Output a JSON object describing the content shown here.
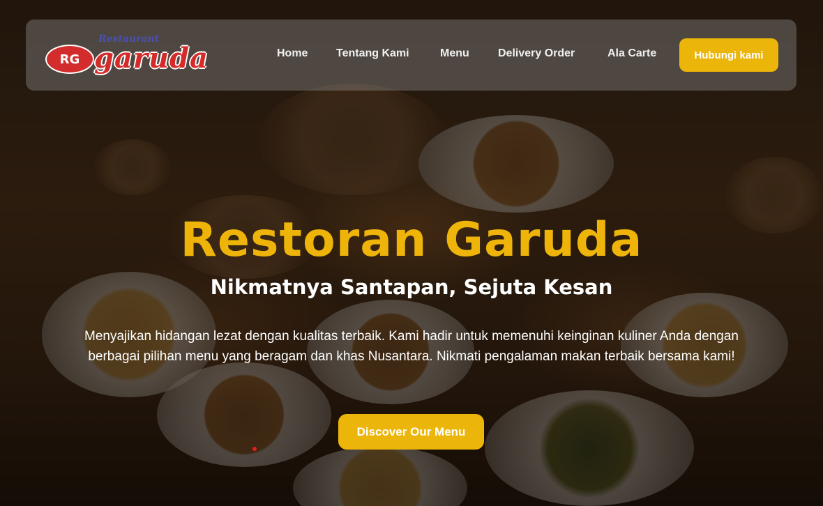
{
  "brand": {
    "logo_small_text": "Restaurant",
    "logo_word": "garuda",
    "logo_emblem_text": "RG",
    "colors": {
      "primary_yellow": "#ecb50a",
      "logo_red": "#d52a2a"
    }
  },
  "nav": {
    "items": [
      {
        "label": "Home"
      },
      {
        "label": "Tentang Kami"
      },
      {
        "label": "Menu"
      },
      {
        "label": "Delivery Order"
      },
      {
        "label": "Ala Carte"
      }
    ],
    "cta_label": "Hubungi kami"
  },
  "hero": {
    "title": "Restoran Garuda",
    "subtitle": "Nikmatnya Santapan, Sejuta Kesan",
    "description": "Menyajikan hidangan lezat dengan kualitas terbaik. Kami hadir untuk memenuhi keinginan kuliner Anda dengan berbagai pilihan menu yang beragam dan khas Nusantara. Nikmati pengalaman makan terbaik bersama kami!",
    "cta_label": "Discover Our Menu"
  }
}
